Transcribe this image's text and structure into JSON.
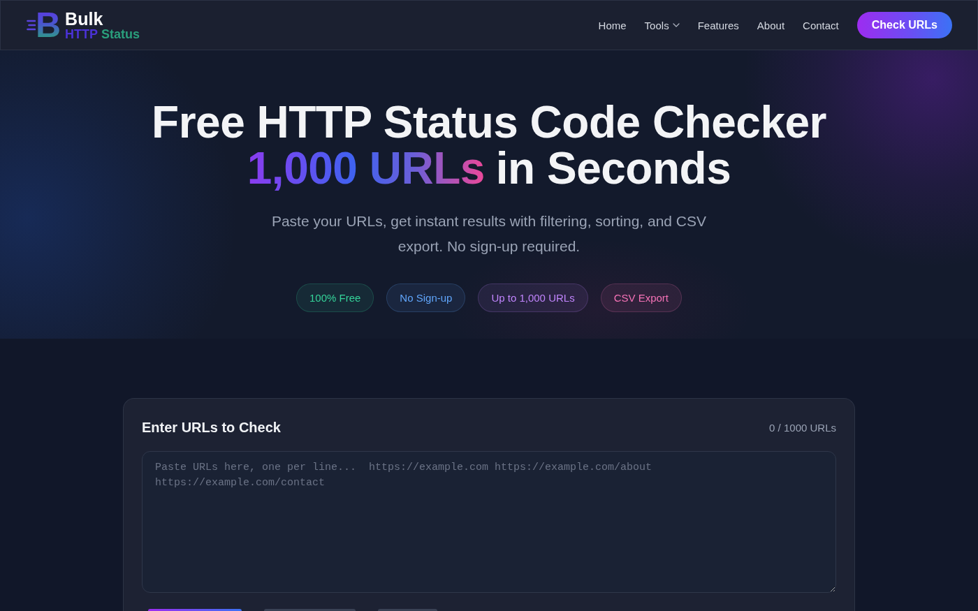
{
  "nav": {
    "logo": {
      "mark": "B",
      "title": "Bulk",
      "subtitle_a": "HTTP",
      "subtitle_b": "Status"
    },
    "links": [
      {
        "label": "Home",
        "kind": "link"
      },
      {
        "label": "Tools",
        "kind": "dropdown"
      },
      {
        "label": "Features",
        "kind": "link"
      },
      {
        "label": "About",
        "kind": "link"
      },
      {
        "label": "Contact",
        "kind": "link"
      }
    ],
    "cta": "Check URLs"
  },
  "hero": {
    "title": "Free HTTP Status Code Checker",
    "title_highlight": "1,000 URLs",
    "title_end": "in Seconds",
    "subtitle": "Paste your URLs, get instant results with filtering, sorting, and CSV export. No sign-up required.",
    "badges": [
      {
        "label": "100% Free",
        "color": "#34d399"
      },
      {
        "label": "No Sign-up",
        "color": "#60a5fa"
      },
      {
        "label": "Up to 1,000 URLs",
        "color": "#c084fc"
      },
      {
        "label": "CSV Export",
        "color": "#f472b6"
      }
    ]
  },
  "url_card": {
    "title": "Enter URLs to Check",
    "counter": "0 / 1000 URLs",
    "input": {
      "placeholder": "Paste URLs here, one per line...  https://example.com https://example.com/about https://example.com/contact"
    },
    "actions": [
      {
        "kind": "primary"
      },
      {
        "kind": "secondary"
      },
      {
        "kind": "secondary"
      }
    ]
  }
}
